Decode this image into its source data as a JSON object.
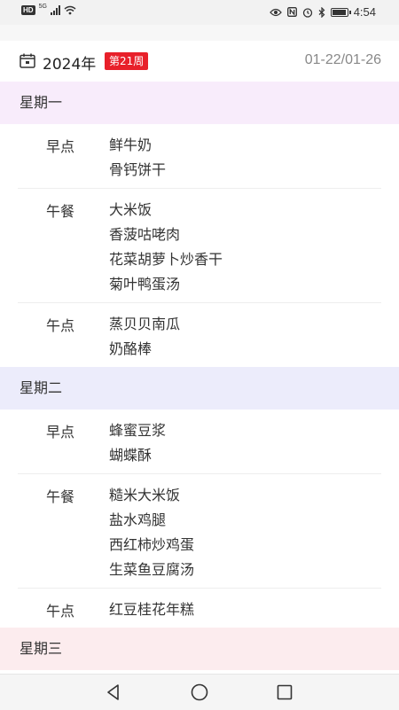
{
  "status_bar": {
    "network_badge": "HD",
    "network_type": "5G",
    "time": "4:54",
    "battery_level": 0.85
  },
  "header": {
    "year": "2024年",
    "week_badge": "第21周",
    "date_range": "01-22/01-26",
    "accent_color": "#e8202a"
  },
  "days": [
    {
      "label": "星期一",
      "bg_color": "#f8ecfb",
      "meals": [
        {
          "name": "早点",
          "dishes": [
            "鲜牛奶",
            "骨钙饼干"
          ]
        },
        {
          "name": "午餐",
          "dishes": [
            "大米饭",
            "香菠咕咾肉",
            "花菜胡萝卜炒香干",
            "菊叶鸭蛋汤"
          ]
        },
        {
          "name": "午点",
          "dishes": [
            "蒸贝贝南瓜",
            "奶酪棒"
          ]
        }
      ]
    },
    {
      "label": "星期二",
      "bg_color": "#ececfb",
      "meals": [
        {
          "name": "早点",
          "dishes": [
            "蜂蜜豆浆",
            "蝴蝶酥"
          ]
        },
        {
          "name": "午餐",
          "dishes": [
            "糙米大米饭",
            "盐水鸡腿",
            "西红柿炒鸡蛋",
            "生菜鱼豆腐汤"
          ]
        },
        {
          "name": "午点",
          "dishes": [
            "红豆桂花年糕"
          ]
        }
      ]
    },
    {
      "label": "星期三",
      "bg_color": "#fcecee",
      "meals": []
    }
  ],
  "nav": {
    "back_icon": "back-triangle-icon",
    "home_icon": "home-circle-icon",
    "recents_icon": "recents-square-icon"
  }
}
